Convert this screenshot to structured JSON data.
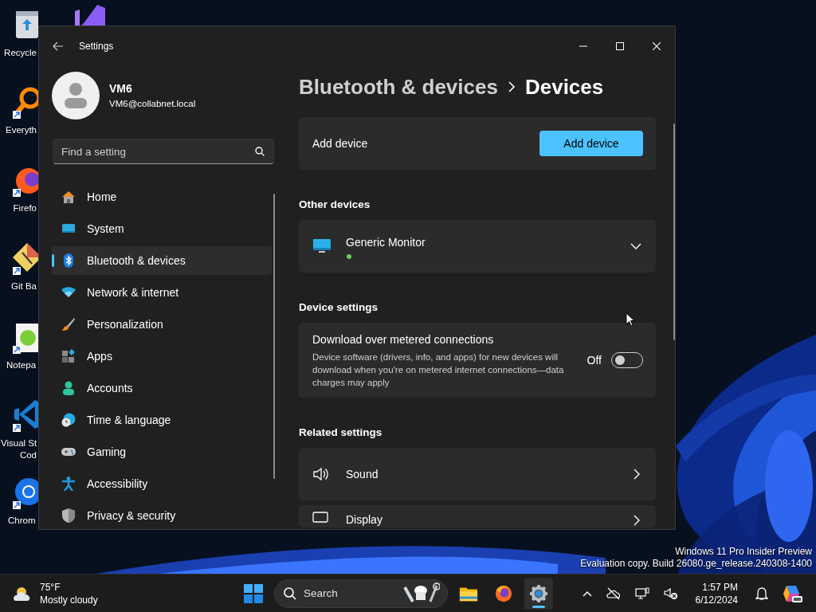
{
  "desktop": {
    "icons": [
      {
        "lines": [
          "Recycle"
        ]
      },
      {
        "lines": [
          "Everyth"
        ]
      },
      {
        "lines": [
          "Firefo"
        ]
      },
      {
        "lines": [
          "Git Ba"
        ]
      },
      {
        "lines": [
          "Notepa"
        ]
      },
      {
        "lines": [
          "Visual St",
          "Cod"
        ]
      },
      {
        "lines": [
          "Chrom"
        ]
      }
    ],
    "build_info": [
      "Windows 11 Pro Insider Preview",
      "Evaluation copy. Build 26080.ge_release.240308-1400"
    ]
  },
  "window": {
    "title": "Settings",
    "user": {
      "name": "VM6",
      "email": "VM6@collabnet.local"
    },
    "search": {
      "placeholder": "Find a setting"
    },
    "nav": [
      {
        "label": "Home",
        "selected": false
      },
      {
        "label": "System",
        "selected": false
      },
      {
        "label": "Bluetooth & devices",
        "selected": true
      },
      {
        "label": "Network & internet",
        "selected": false
      },
      {
        "label": "Personalization",
        "selected": false
      },
      {
        "label": "Apps",
        "selected": false
      },
      {
        "label": "Accounts",
        "selected": false
      },
      {
        "label": "Time & language",
        "selected": false
      },
      {
        "label": "Gaming",
        "selected": false
      },
      {
        "label": "Accessibility",
        "selected": false
      },
      {
        "label": "Privacy & security",
        "selected": false
      }
    ],
    "breadcrumb": {
      "parent": "Bluetooth & devices",
      "current": "Devices"
    },
    "sections": [
      {
        "kind": "action",
        "label": "Add device",
        "button": "Add device"
      },
      {
        "kind": "heading",
        "label": "Other devices"
      },
      {
        "kind": "device",
        "label": "Generic Monitor",
        "color": "#6ccb5f",
        "expanded": false
      },
      {
        "kind": "heading",
        "label": "Device settings"
      },
      {
        "kind": "toggle",
        "label": "Download over metered connections",
        "description": "Device software (drivers, info, and apps) for new devices will download when you're on metered internet connections—data charges may apply",
        "state": "Off",
        "on": false
      },
      {
        "kind": "heading",
        "label": "Related settings"
      },
      {
        "kind": "link",
        "label": "Sound"
      },
      {
        "kind": "link",
        "label": "Display"
      }
    ]
  },
  "taskbar": {
    "weather": {
      "temperature": "75°F",
      "condition": "Mostly cloudy"
    },
    "search": {
      "placeholder": "Search"
    },
    "apps": [
      {
        "selected": false
      },
      {
        "selected": false
      },
      {
        "selected": true
      }
    ],
    "clock": {
      "time": "1:57 PM",
      "date": "6/12/2024"
    }
  }
}
